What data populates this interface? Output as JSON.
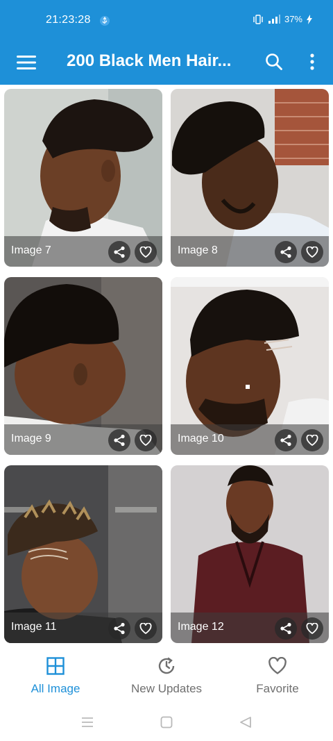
{
  "status_bar": {
    "time": "21:23:28",
    "battery": "37%"
  },
  "app_bar": {
    "title": "200 Black Men Hair..."
  },
  "colors": {
    "primary": "#1e90d8",
    "nav_inactive": "#6f6f6f"
  },
  "gallery": {
    "items": [
      {
        "label": "Image 7"
      },
      {
        "label": "Image 8"
      },
      {
        "label": "Image 9"
      },
      {
        "label": "Image 10"
      },
      {
        "label": "Image 11"
      },
      {
        "label": "Image 12"
      }
    ]
  },
  "bottom_nav": {
    "items": [
      {
        "label": "All Image",
        "icon": "grid-icon",
        "active": true
      },
      {
        "label": "New Updates",
        "icon": "refresh-clock-icon",
        "active": false
      },
      {
        "label": "Favorite",
        "icon": "heart-icon",
        "active": false
      }
    ]
  },
  "system_nav": {
    "buttons": [
      "recents-icon",
      "home-icon",
      "back-icon"
    ]
  }
}
